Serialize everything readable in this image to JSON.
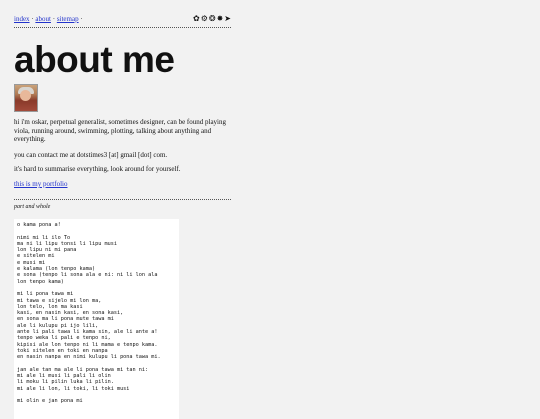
{
  "nav": {
    "index": "index",
    "about": "about",
    "sitemap": "sitemap",
    "sep": "·",
    "icons": [
      "flower-icon",
      "gear-icon",
      "emblem-icon",
      "star-icon",
      "bird-icon"
    ]
  },
  "page": {
    "title": "about me",
    "bio": "hi i'm oskar, perpetual generalist, sometimes designer, can be found playing viola, running around, swimming, plotting, talking about anything and everything.",
    "contact": "you can contact me at dotstimes3 [at] gmail [dot] com.",
    "summary": "it's hard to summarise everything, look around for yourself.",
    "portfolio_link": "this is my portfolio"
  },
  "section": {
    "label": "part and whole"
  },
  "poem": {
    "text": "o kama pona a!\n\nnimi mi li ilo To\nma ni li lipu tonsi li lipu musi\nlon lipu ni mi pana\ne sitelen mi\ne musi mi\ne kalama (lon tenpo kama)\ne sona (tenpo li sona ala e ni: ni li lon ala\nlon tenpo kama)\n\nmi li pona tawa mi\nmi tawa e sijelo mi lon ma,\nlon telo, lon ma kasi\nkasi, en nasin kasi, en sona kasi,\nen sona ma li pona mute tawa mi\nale li kulupu pi ijo lili,\nante li pali tawa li kama sin, ale li ante a!\ntenpo weka li pali e tenpo ni,\nkipisi ale lon tenpo ni li mama e tenpo kama.\ntoki sitelen en toki en nanpa\nen nasin nanpa en nimi kulupu li pona tawa mi.\n\njan ale tan ma ale li pona tawa mi tan ni:\nmi ale li musi li pali li olin\nli moku li pilin luka li pilin.\nmi ale li lon, li toki, li toki musi\n\nmi olin e jan pona mi"
  }
}
